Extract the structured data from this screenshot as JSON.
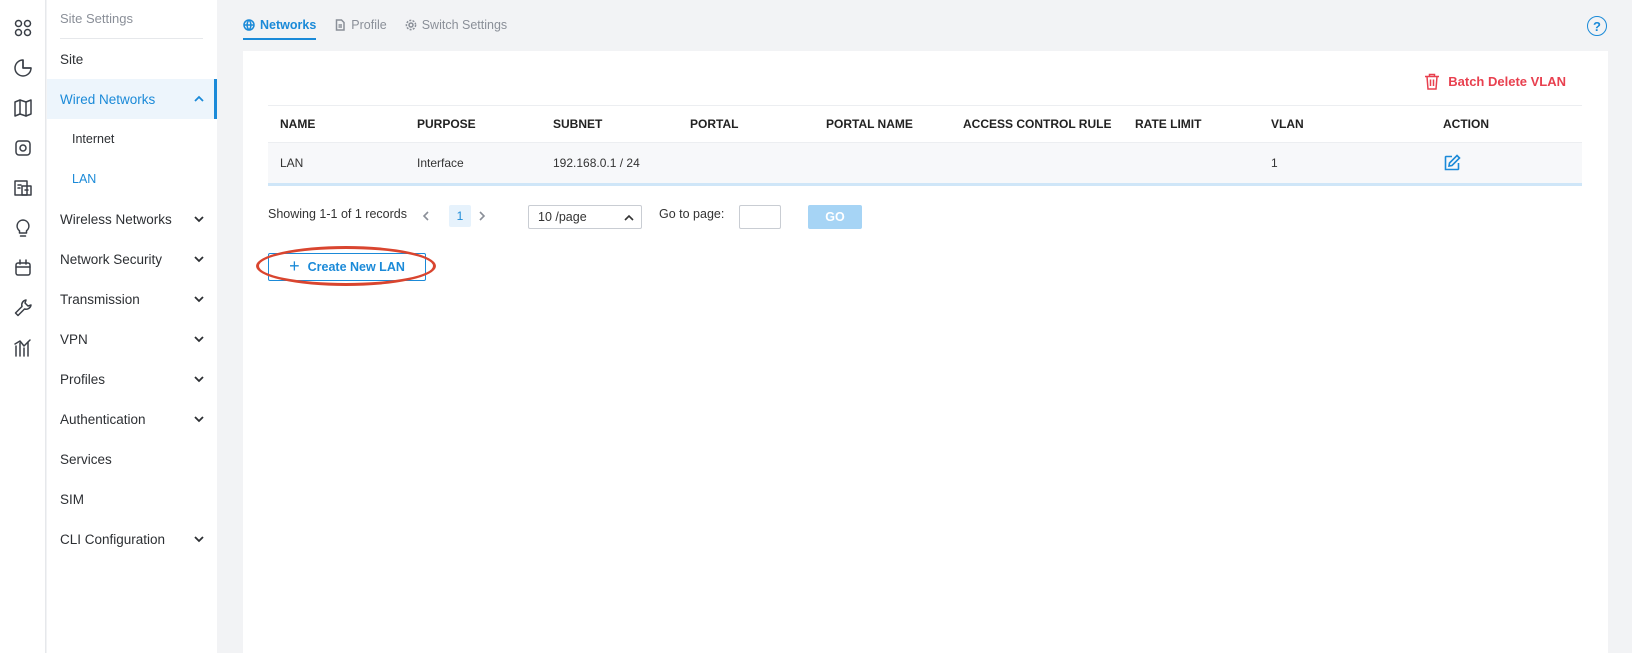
{
  "rail": {
    "icons": [
      "apps-grid-icon",
      "pie-chart-icon",
      "map-icon",
      "device-icon",
      "building-icon",
      "lightbulb-icon",
      "calendar-icon",
      "wrench-icon",
      "analytics-icon"
    ]
  },
  "sidebar": {
    "title": "Site Settings",
    "items": [
      {
        "label": "Site"
      },
      {
        "label": "Wired Networks"
      },
      {
        "label": "Internet"
      },
      {
        "label": "LAN"
      },
      {
        "label": "Wireless Networks"
      },
      {
        "label": "Network Security"
      },
      {
        "label": "Transmission"
      },
      {
        "label": "VPN"
      },
      {
        "label": "Profiles"
      },
      {
        "label": "Authentication"
      },
      {
        "label": "Services"
      },
      {
        "label": "SIM"
      },
      {
        "label": "CLI Configuration"
      }
    ]
  },
  "tabs": [
    {
      "label": "Networks"
    },
    {
      "label": "Profile"
    },
    {
      "label": "Switch Settings"
    }
  ],
  "help": {
    "label": "?"
  },
  "toolbar": {
    "batch_delete_label": "Batch Delete VLAN"
  },
  "table": {
    "columns": [
      "NAME",
      "PURPOSE",
      "SUBNET",
      "PORTAL",
      "PORTAL NAME",
      "ACCESS CONTROL RULE",
      "RATE LIMIT",
      "VLAN",
      "ACTION"
    ],
    "rows": [
      {
        "name": "LAN",
        "purpose": "Interface",
        "subnet": "192.168.0.1 / 24",
        "portal": "",
        "portal_name": "",
        "acl": "",
        "rate_limit": "",
        "vlan": "1"
      }
    ]
  },
  "pagination": {
    "info": "Showing 1-1 of 1 records",
    "current_page": "1",
    "page_size": "10 /page",
    "goto_label": "Go to page:",
    "goto_value": "",
    "go_label": "GO"
  },
  "actions": {
    "create_label": "Create New LAN"
  },
  "colors": {
    "accent": "#1b8ad8",
    "danger": "#e8404f",
    "highlight": "#d9452f"
  }
}
